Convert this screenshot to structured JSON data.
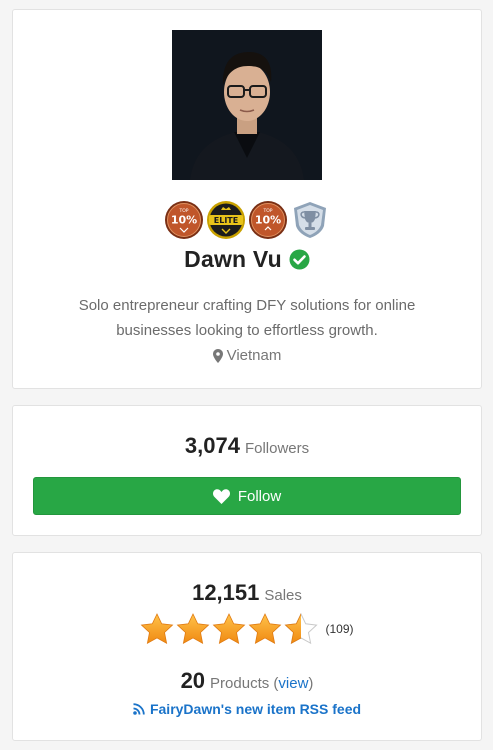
{
  "profile": {
    "name": "Dawn Vu",
    "bio_line1": "Solo entrepreneur crafting DFY solutions for online",
    "bio_line2": "businesses looking to effortless growth.",
    "location": "Vietnam",
    "badges": [
      {
        "icon": "top-10-percent-badge-icon",
        "text": "10%",
        "small": "TOP"
      },
      {
        "icon": "elite-badge-icon",
        "text": "ELITE"
      },
      {
        "icon": "top-10-percent-badge-icon",
        "text": "10%",
        "small": "TOP"
      },
      {
        "icon": "trophy-shield-badge-icon"
      }
    ],
    "verified_icon": "check-circle-icon",
    "location_icon": "map-pin-icon"
  },
  "followers": {
    "count": "3,074",
    "label": "Followers",
    "follow_button": "Follow",
    "button_icon": "heart-icon",
    "button_color": "#28a745"
  },
  "sales": {
    "count": "12,151",
    "label": "Sales",
    "rating": 4.5,
    "rating_count": "(109)",
    "products_count": "20",
    "products_label": "Products (",
    "view_label": "view",
    "products_close": ")",
    "rss_label": "FairyDawn's new item RSS feed",
    "rss_icon": "rss-icon",
    "link_color": "#1a73c9"
  }
}
